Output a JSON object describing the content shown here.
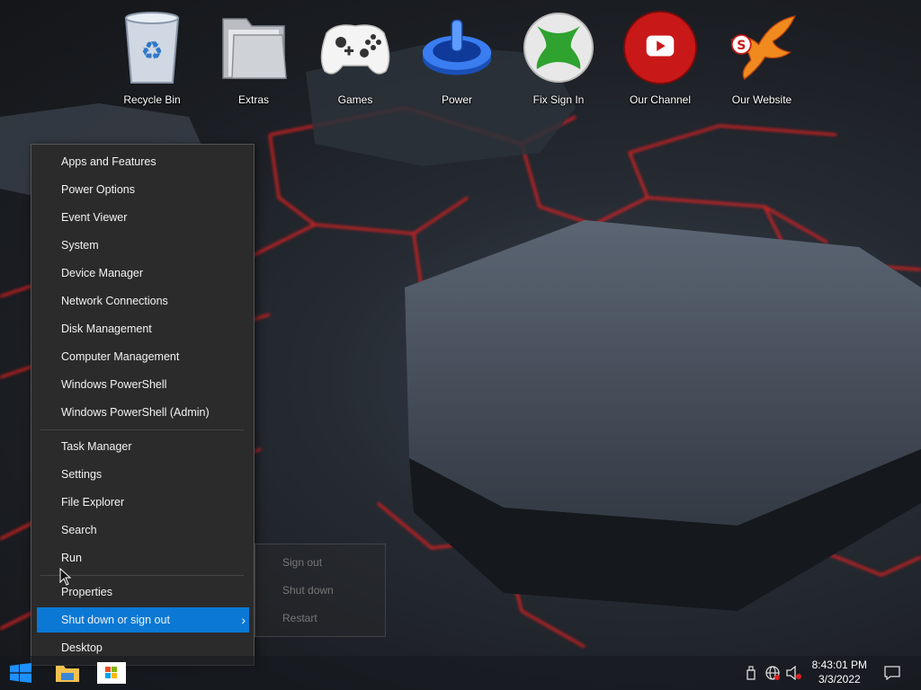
{
  "desktop": {
    "icons": [
      {
        "label": "Recycle Bin",
        "icon": "recycle-bin-icon"
      },
      {
        "label": "Extras",
        "icon": "folder-icon"
      },
      {
        "label": "Games",
        "icon": "gamepad-icon"
      },
      {
        "label": "Power",
        "icon": "power-icon"
      },
      {
        "label": "Fix Sign In",
        "icon": "xbox-icon"
      },
      {
        "label": "Our Channel",
        "icon": "youtube-icon"
      },
      {
        "label": "Our Website",
        "icon": "phoenix-logo-icon"
      }
    ]
  },
  "menu": {
    "group1": [
      "Apps and Features",
      "Power Options",
      "Event Viewer",
      "System",
      "Device Manager",
      "Network Connections",
      "Disk Management",
      "Computer Management",
      "Windows PowerShell",
      "Windows PowerShell (Admin)"
    ],
    "group2": [
      "Task Manager",
      "Settings",
      "File Explorer",
      "Search",
      "Run"
    ],
    "group3": [
      "Properties",
      "Shut down or sign out",
      "Desktop"
    ],
    "highlighted": "Shut down or sign out"
  },
  "submenu": {
    "items": [
      "Sign out",
      "Shut down",
      "Restart"
    ]
  },
  "taskbar": {
    "time": "8:43:01 PM",
    "date": "3/3/2022"
  },
  "colors": {
    "accent": "#0a78d4",
    "menu_bg": "#2b2b2b",
    "wallpaper_lines": "#e02020"
  }
}
